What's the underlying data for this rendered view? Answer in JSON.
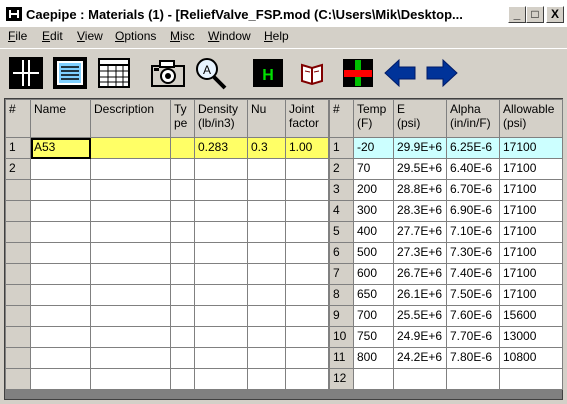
{
  "window": {
    "title": "Caepipe : Materials  (1)  -  [ReliefValve_FSP.mod (C:\\Users\\Mik\\Desktop...",
    "min_glyph": "_",
    "max_glyph": "□",
    "close_glyph": "X"
  },
  "menu": {
    "items": [
      {
        "first": "F",
        "rest": "ile"
      },
      {
        "first": "E",
        "rest": "dit"
      },
      {
        "first": "V",
        "rest": "iew"
      },
      {
        "first": "O",
        "rest": "ptions"
      },
      {
        "first": "M",
        "rest": "isc"
      },
      {
        "first": "W",
        "rest": "indow"
      },
      {
        "first": "H",
        "rest": "elp"
      }
    ]
  },
  "toolbar": {
    "icons": [
      "grid-cross-icon",
      "document-lines-icon",
      "table-columns-icon",
      "camera-icon",
      "magnifier-icon",
      "h-button-icon",
      "book-icon",
      "red-cross-icon",
      "arrow-left-icon",
      "arrow-right-icon"
    ],
    "h_label": "H"
  },
  "left_table": {
    "headers": [
      "#",
      "Name",
      "Description",
      "Ty\npe",
      "Density\n(lb/in3)",
      "Nu",
      "Joint\nfactor"
    ],
    "rows": [
      [
        "1",
        "A53",
        "",
        "",
        "0.283",
        "0.3",
        "1.00"
      ],
      [
        "2",
        "",
        "",
        "",
        "",
        "",
        ""
      ],
      [
        "",
        "",
        "",
        "",
        "",
        "",
        ""
      ],
      [
        "",
        "",
        "",
        "",
        "",
        "",
        ""
      ],
      [
        "",
        "",
        "",
        "",
        "",
        "",
        ""
      ],
      [
        "",
        "",
        "",
        "",
        "",
        "",
        ""
      ],
      [
        "",
        "",
        "",
        "",
        "",
        "",
        ""
      ],
      [
        "",
        "",
        "",
        "",
        "",
        "",
        ""
      ],
      [
        "",
        "",
        "",
        "",
        "",
        "",
        ""
      ],
      [
        "",
        "",
        "",
        "",
        "",
        "",
        ""
      ],
      [
        "",
        "",
        "",
        "",
        "",
        "",
        ""
      ],
      [
        "",
        "",
        "",
        "",
        "",
        "",
        ""
      ]
    ]
  },
  "right_table": {
    "headers": [
      "#",
      "Temp\n(F)",
      "E\n(psi)",
      "Alpha\n(in/in/F)",
      "Allowable\n(psi)"
    ],
    "rows": [
      [
        "1",
        "-20",
        "29.9E+6",
        "6.25E-6",
        "17100"
      ],
      [
        "2",
        "70",
        "29.5E+6",
        "6.40E-6",
        "17100"
      ],
      [
        "3",
        "200",
        "28.8E+6",
        "6.70E-6",
        "17100"
      ],
      [
        "4",
        "300",
        "28.3E+6",
        "6.90E-6",
        "17100"
      ],
      [
        "5",
        "400",
        "27.7E+6",
        "7.10E-6",
        "17100"
      ],
      [
        "6",
        "500",
        "27.3E+6",
        "7.30E-6",
        "17100"
      ],
      [
        "7",
        "600",
        "26.7E+6",
        "7.40E-6",
        "17100"
      ],
      [
        "8",
        "650",
        "26.1E+6",
        "7.50E-6",
        "17100"
      ],
      [
        "9",
        "700",
        "25.5E+6",
        "7.60E-6",
        "15600"
      ],
      [
        "10",
        "750",
        "24.9E+6",
        "7.70E-6",
        "13000"
      ],
      [
        "11",
        "800",
        "24.2E+6",
        "7.80E-6",
        "10800"
      ],
      [
        "12",
        "",
        "",
        "",
        ""
      ]
    ]
  }
}
